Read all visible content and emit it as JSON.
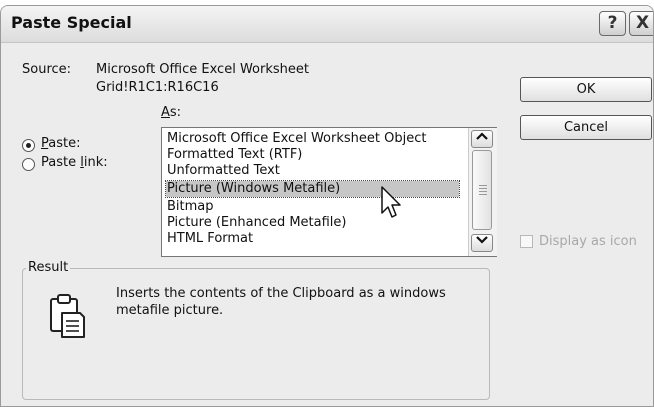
{
  "dialog": {
    "title": "Paste Special",
    "help_glyph": "?",
    "close_glyph": "X"
  },
  "source": {
    "label": "Source:",
    "line1": "Microsoft Office Excel Worksheet",
    "line2": "Grid!R1C1:R16C16"
  },
  "as_label": "As:",
  "options": {
    "paste_label": "Paste:",
    "paste_link_label": "Paste link:",
    "selected": "Paste:"
  },
  "list": {
    "items": [
      "Microsoft Office Excel Worksheet Object",
      "Formatted Text (RTF)",
      "Unformatted Text",
      "Picture (Windows Metafile)",
      "Bitmap",
      "Picture (Enhanced Metafile)",
      "HTML Format"
    ],
    "selected": "Picture (Windows Metafile)"
  },
  "buttons": {
    "ok": "OK",
    "cancel": "Cancel"
  },
  "display_as_icon": {
    "label": "Display as icon",
    "checked": false,
    "enabled": false
  },
  "result": {
    "label": "Result",
    "line1": "Inserts the contents of the Clipboard as a windows",
    "line2": "metafile picture."
  },
  "icons": {
    "clipboard": "clipboard-icon",
    "cursor": "mouse-pointer-icon"
  }
}
